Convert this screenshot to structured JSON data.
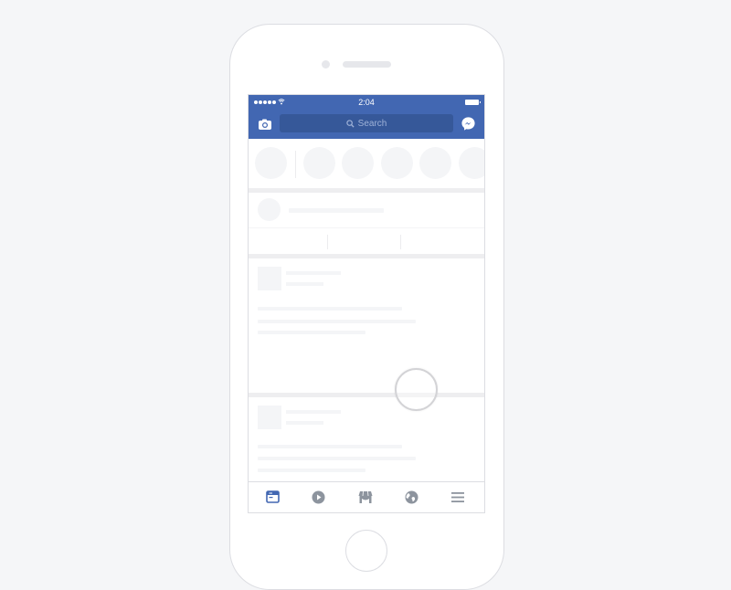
{
  "device": {
    "type": "phone-mockup"
  },
  "status_bar": {
    "signal_bars": 5,
    "wifi": "wifi-icon",
    "time": "2:04",
    "battery": "battery-icon"
  },
  "nav_bar": {
    "left_icon": "camera-icon",
    "search_placeholder": "Search",
    "right_icon": "messenger-icon",
    "brand_color": "#4267b2",
    "search_bg_color": "#365899"
  },
  "stories": {
    "count": 6,
    "state": "loading-placeholder"
  },
  "composer": {
    "state": "loading-placeholder",
    "action_count": 3
  },
  "feed": {
    "posts": [
      {
        "state": "loading-placeholder"
      },
      {
        "state": "loading-placeholder"
      }
    ]
  },
  "tab_bar": {
    "tabs": [
      {
        "name": "news-feed",
        "icon": "news-feed-icon",
        "active": true
      },
      {
        "name": "watch",
        "icon": "play-icon",
        "active": false
      },
      {
        "name": "marketplace",
        "icon": "store-icon",
        "active": false
      },
      {
        "name": "notifications",
        "icon": "globe-icon",
        "active": false
      },
      {
        "name": "menu",
        "icon": "hamburger-icon",
        "active": false
      }
    ],
    "active_color": "#4267b2",
    "inactive_color": "#8d949e"
  },
  "touch_indicator": {
    "visible": true
  }
}
